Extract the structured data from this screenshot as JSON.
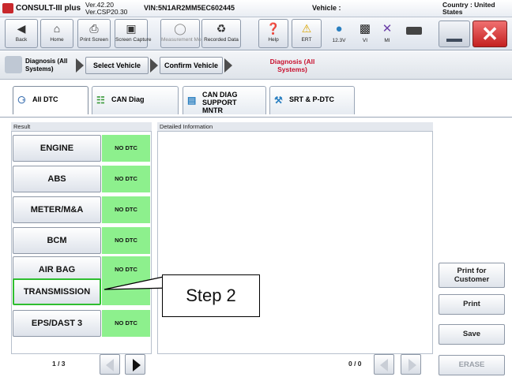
{
  "titlebar": {
    "app": "CONSULT-III plus",
    "ver_line1": "Ver.42.20",
    "ver_line2": "Ver.CSP20.30",
    "vin": "VIN:5N1AR2MM5EC602445",
    "vehicle": "Vehicle :",
    "country_line1": "Country : United",
    "country_line2": "States"
  },
  "toolbar": {
    "back": "Back",
    "home": "Home",
    "print_screen": "Print Screen",
    "screen_capture": "Screen Capture",
    "measurement_mode": "Measurement Mode",
    "recorded_data": "Recorded Data",
    "help": "Help",
    "ert": "ERT",
    "voltage": "12.3V",
    "vi": "VI",
    "mi": "MI"
  },
  "breadcrumb": {
    "diagnosis_all": "Diagnosis (All Systems)",
    "select_vehicle": "Select Vehicle",
    "confirm_vehicle": "Confirm Vehicle",
    "current": "Diagnosis (All Systems)"
  },
  "tabs": [
    {
      "label": "All DTC"
    },
    {
      "label": "CAN Diag"
    },
    {
      "label": "CAN DIAG SUPPORT MNTR"
    },
    {
      "label": "SRT & P-DTC"
    }
  ],
  "result_header": "Result",
  "detail_header": "Detailed Information",
  "results": [
    {
      "system": "ENGINE",
      "status": "NO DTC"
    },
    {
      "system": "ABS",
      "status": "NO DTC"
    },
    {
      "system": "METER/M&A",
      "status": "NO DTC"
    },
    {
      "system": "BCM",
      "status": "NO DTC"
    },
    {
      "system": "AIR BAG",
      "status": "NO DTC"
    },
    {
      "system": "TRANSMISSION",
      "status": ""
    },
    {
      "system": "EPS/DAST 3",
      "status": "NO DTC"
    }
  ],
  "callout": "Step 2",
  "page_indicator": "1 / 3",
  "detail_count": "0 / 0",
  "actions": {
    "print_customer": "Print for Customer",
    "print": "Print",
    "save": "Save",
    "erase": "ERASE"
  },
  "colors": {
    "no_dtc_green": "#8df08d",
    "highlight_green": "#2fbe2f",
    "breadcrumb_red": "#c8102e"
  }
}
